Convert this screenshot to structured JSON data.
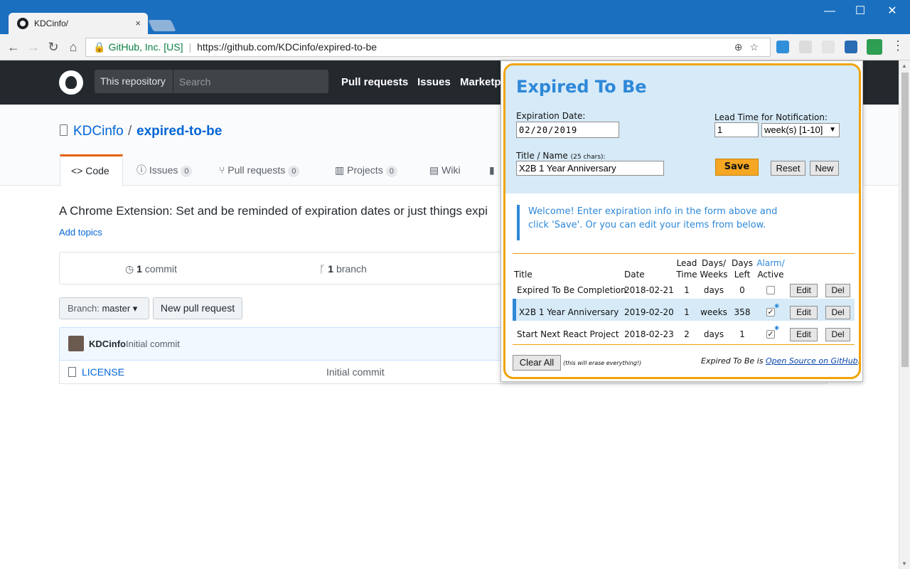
{
  "browser": {
    "tab_title": "KDCinfo/",
    "tab_close": "×",
    "window_controls": {
      "minimize": "—",
      "maximize": "☐",
      "close": "✕"
    },
    "nav": {
      "back": "←",
      "forward": "→",
      "reload": "↻",
      "home": "⌂"
    },
    "address": {
      "org": "GitHub, Inc. [US]",
      "url": "https://github.com/KDCinfo/expired-to-be"
    },
    "omni_icons": "⊕☆",
    "menu": "⋮",
    "extension_colors": [
      "#2f8fd8",
      "#dcdcdc",
      "#e4e4e4",
      "#2a6db5",
      "#2e9e52"
    ]
  },
  "github": {
    "scope": "This repository",
    "search_placeholder": "Search",
    "nav": [
      "Pull requests",
      "Issues",
      "Marketp"
    ],
    "owner": "KDCinfo",
    "slash": "/",
    "repo": "expired-to-be",
    "tabs": [
      {
        "label": "<> Code"
      },
      {
        "label": "ⓘ Issues",
        "count": "0"
      },
      {
        "label": "Pull requests",
        "count": "0"
      },
      {
        "label": "Projects",
        "count": "0"
      },
      {
        "label": "Wiki"
      }
    ],
    "description": "A Chrome Extension: Set and be reminded of expiration dates or just things expi",
    "add_topics": "Add topics",
    "commits": {
      "count": "1",
      "label": "commit"
    },
    "branches": {
      "count": "1",
      "label": "branch"
    },
    "branch_button": {
      "label": "Branch:",
      "value": "master ▾"
    },
    "new_pr": "New pull request",
    "latest_commit": {
      "author": "KDCinfo",
      "message": "Initial commit"
    },
    "files": [
      {
        "name": "LICENSE",
        "message": "Initial commit"
      }
    ]
  },
  "popup": {
    "title": "Expired To Be",
    "expiration_label": "Expiration Date:",
    "expiration_value": "02/20/2019",
    "lead_label": "Lead Time for Notification:",
    "lead_value": "1",
    "lead_unit": "week(s) [1-10]",
    "title_label": "Title / Name",
    "title_hint": "(25 chars):",
    "title_value": "X2B 1 Year Anniversary",
    "save": "Save",
    "reset": "Reset",
    "new": "New",
    "welcome": "Welcome! Enter expiration info in the form above and click 'Save'. Or you can edit your items from below.",
    "columns": {
      "title": "Title",
      "date": "Date",
      "lead_1": "Lead",
      "lead_2": "Time",
      "dw_1": "Days/",
      "dw_2": "Weeks",
      "left_1": "Days",
      "left_2": "Left",
      "alarm_1": "Alarm/",
      "alarm_2": "Active"
    },
    "rows": [
      {
        "title": "Expired To Be Completion",
        "date": "2018-02-21",
        "lead": "1",
        "unit": "days",
        "left": "0",
        "active": false,
        "edit": "Edit",
        "del": "Del"
      },
      {
        "title": "X2B 1 Year Anniversary",
        "date": "2019-02-20",
        "lead": "1",
        "unit": "weeks",
        "left": "358",
        "active": true,
        "edit": "Edit",
        "del": "Del"
      },
      {
        "title": "Start Next React Project",
        "date": "2018-02-23",
        "lead": "2",
        "unit": "days",
        "left": "1",
        "active": true,
        "edit": "Edit",
        "del": "Del"
      }
    ],
    "clear_all": "Clear All",
    "clear_note": "(this will erase everything!)",
    "footer_prefix": "Expired To Be is ",
    "footer_link": "Open Source on GitHub",
    "footer_suffix": ".",
    "colors": {
      "accent": "#2e88d8",
      "border": "#f0a30a",
      "save": "#f5a623",
      "form_bg": "#d6eaf8"
    }
  }
}
